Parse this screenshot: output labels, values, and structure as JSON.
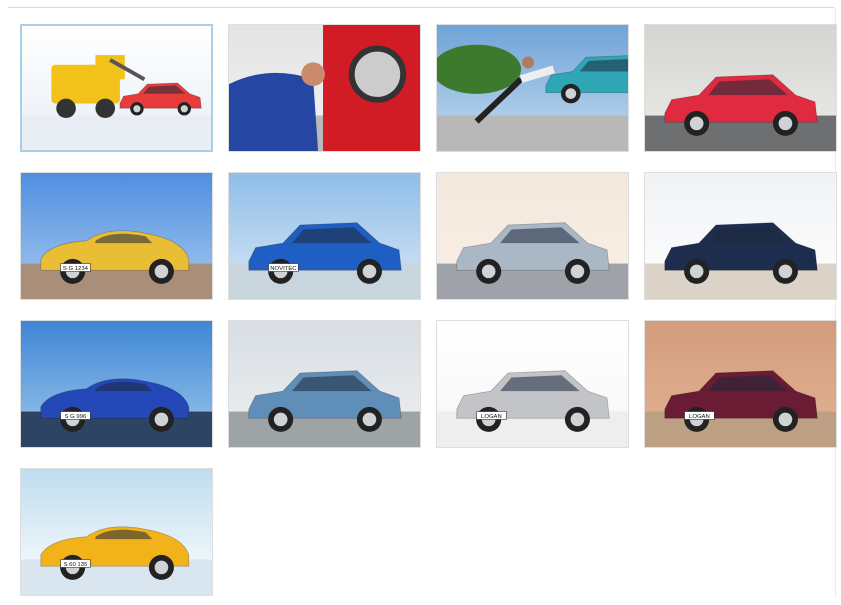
{
  "gallery": {
    "selected_index": 0,
    "items": [
      {
        "id": "tow-truck",
        "plate": "",
        "icon": "tow-truck-icon",
        "colors": {
          "bg1": "#ffffff",
          "bg2": "#e8eef6",
          "ground": "#e9eef5",
          "car": "#e83c3c",
          "truck": "#f2c21a"
        }
      },
      {
        "id": "mechanic",
        "plate": "",
        "icon": "mechanic-icon",
        "colors": {
          "bg1": "#e4e4e4",
          "bg2": "#f2f2f2",
          "ground": "#b9b9b9",
          "car": "#d21c25",
          "person": "#2546a3"
        }
      },
      {
        "id": "push-car",
        "plate": "",
        "icon": "person-pushing-car-icon",
        "colors": {
          "bg1": "#6fa3d8",
          "bg2": "#c5dcef",
          "ground": "#b8b8b8",
          "car": "#2fa6b5",
          "trees": "#3d7a2e"
        }
      },
      {
        "id": "red-hatchback",
        "plate": "",
        "icon": "red-hatchback-icon",
        "colors": {
          "bg1": "#d4d4d0",
          "bg2": "#ecece8",
          "ground": "#6d6f70",
          "car": "#df2a3f"
        }
      },
      {
        "id": "yellow-911",
        "plate": "S G 1234",
        "icon": "yellow-sports-car-icon",
        "colors": {
          "bg1": "#4f8fe0",
          "bg2": "#a8c9ef",
          "ground": "#a98e7a",
          "car": "#e9bd34"
        }
      },
      {
        "id": "blue-sedan",
        "plate": "NOVITEC",
        "icon": "blue-sedan-icon",
        "colors": {
          "bg1": "#8fbde8",
          "bg2": "#d7e8f6",
          "ground": "#c9d5dc",
          "car": "#1f5fc4"
        }
      },
      {
        "id": "silver-prius",
        "plate": "",
        "icon": "silver-hybrid-car-icon",
        "colors": {
          "bg1": "#f4e8dc",
          "bg2": "#f7efe6",
          "ground": "#9fa2a8",
          "car": "#aab8c6"
        }
      },
      {
        "id": "dark-suv",
        "plate": "",
        "icon": "dark-blue-crossover-icon",
        "colors": {
          "bg1": "#f0f2f4",
          "bg2": "#ffffff",
          "ground": "#dcd3c8",
          "car": "#1d2d4d"
        }
      },
      {
        "id": "blue-911",
        "plate": "S G 996",
        "icon": "blue-sports-car-icon",
        "colors": {
          "bg1": "#3e86d4",
          "bg2": "#9fc8ee",
          "ground": "#2d4563",
          "car": "#2548b8"
        }
      },
      {
        "id": "blue-pt",
        "plate": "",
        "icon": "blue-retro-wagon-icon",
        "colors": {
          "bg1": "#d7dde2",
          "bg2": "#eef1f3",
          "ground": "#9ea3a6",
          "car": "#5f8fb8"
        }
      },
      {
        "id": "silver-logan",
        "plate": "LOGAN",
        "icon": "silver-sedan-icon",
        "colors": {
          "bg1": "#ffffff",
          "bg2": "#f6f6f6",
          "ground": "#eeeeee",
          "car": "#c2c4c7"
        }
      },
      {
        "id": "red-logan",
        "plate": "LOGAN",
        "icon": "maroon-sedan-icon",
        "colors": {
          "bg1": "#d29c7d",
          "bg2": "#e3b493",
          "ground": "#bda084",
          "car": "#6a1c34"
        }
      },
      {
        "id": "yellow-997",
        "plate": "S 60 135",
        "icon": "yellow-convertible-icon",
        "colors": {
          "bg1": "#bfdcee",
          "bg2": "#ffffff",
          "ground": "#d9e6ef",
          "car": "#f1b21a"
        }
      }
    ]
  }
}
